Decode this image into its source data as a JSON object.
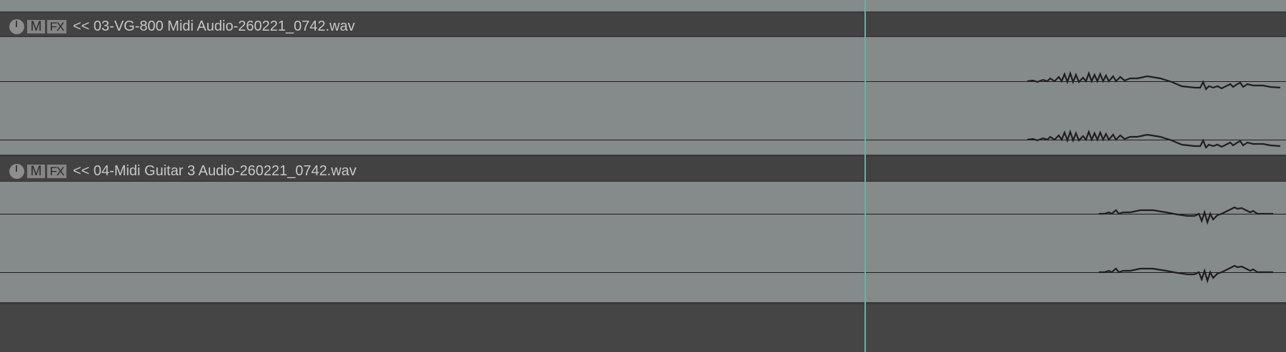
{
  "tracks": [
    {
      "id": "track-03",
      "name_label": "<< 03-VG-800 Midi Audio-260221_0742.wav",
      "buttons": {
        "mute_label": "M",
        "fx_label": "FX"
      }
    },
    {
      "id": "track-04",
      "name_label": "<< 04-Midi Guitar 3 Audio-260221_0742.wav",
      "buttons": {
        "mute_label": "M",
        "fx_label": "FX"
      }
    }
  ],
  "colors": {
    "item_background": "#858a8a",
    "header_background": "#424242",
    "play_cursor": "#62b3a6",
    "waveform": "#1e1e1e",
    "empty_area": "#454545"
  },
  "icons": [
    "volume-knob-icon",
    "mute-button",
    "fx-button"
  ]
}
